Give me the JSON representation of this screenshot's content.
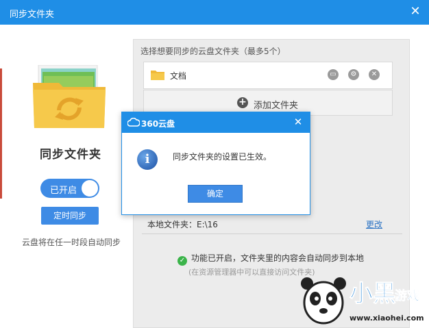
{
  "window": {
    "title": "同步文件夹"
  },
  "left": {
    "title": "同步文件夹",
    "toggle_label": "已开启",
    "schedule_button": "定时同步",
    "note": "云盘将在任一时段自动同步"
  },
  "right": {
    "header": "选择想要同步的云盘文件夹（最多5个）",
    "folders": [
      {
        "name": "文档"
      }
    ],
    "add_label": "添加文件夹",
    "local_folder_label": "本地文件夹：E:\\16",
    "change_link": "更改",
    "status": "功能已开启，文件夹里的内容会自动同步到本地",
    "status_sub": "(在资源管理器中可以直接访问文件夹)"
  },
  "dialog": {
    "title": "360云盘",
    "message": "同步文件夹的设置已生效。",
    "ok_button": "确定"
  },
  "watermark": {
    "brand": "小黑游戏",
    "url": "www.xiaohei.com"
  },
  "colors": {
    "accent": "#1f8ee6",
    "button": "#3e8be5",
    "success": "#3bb44a"
  }
}
